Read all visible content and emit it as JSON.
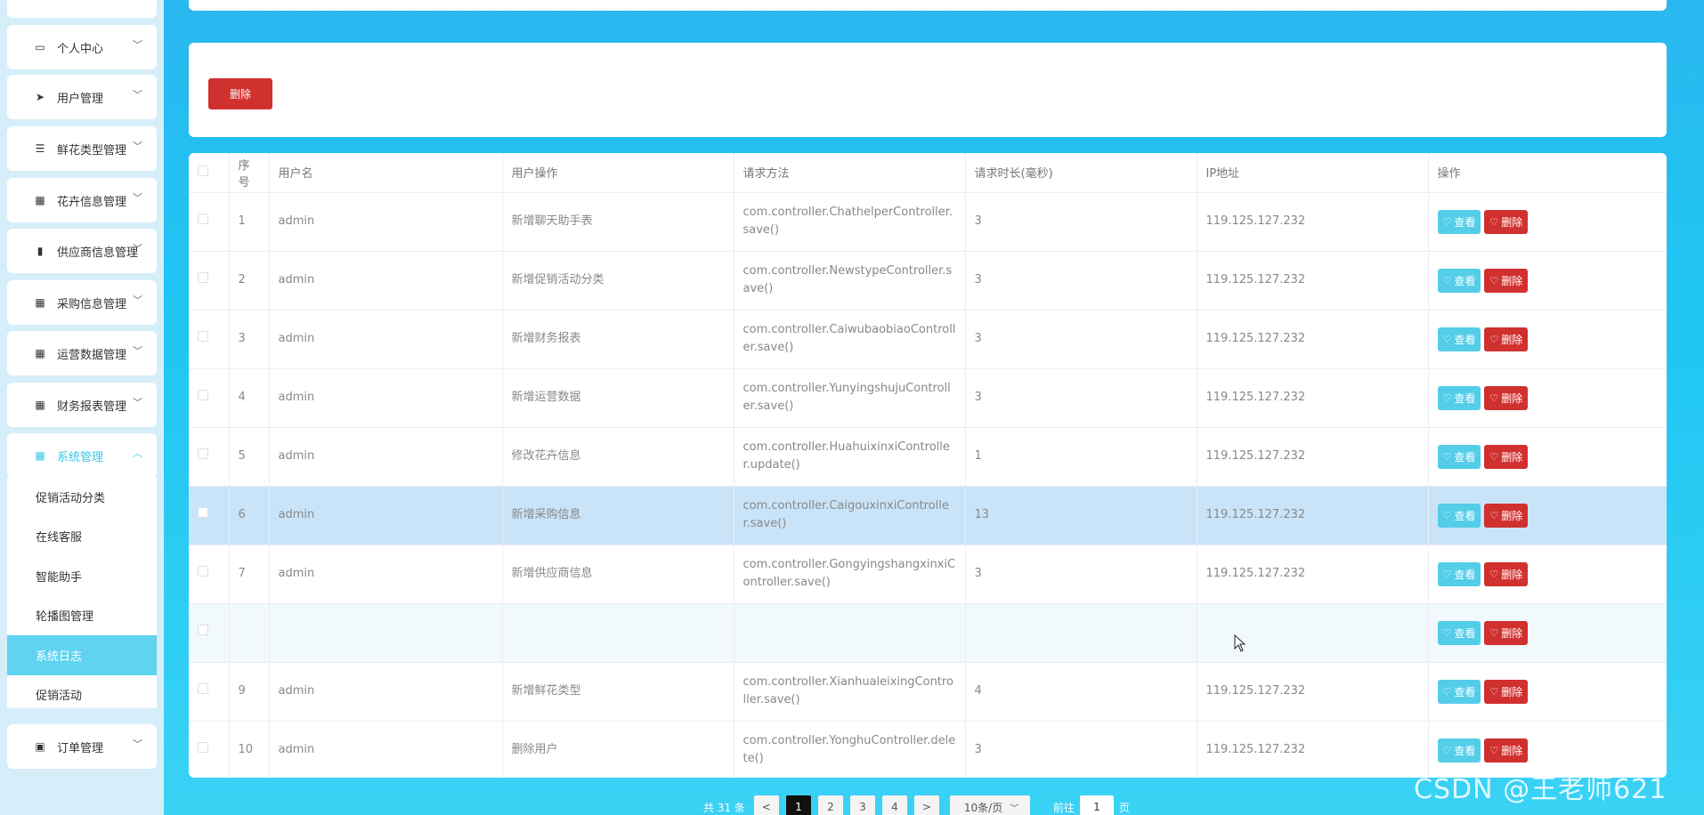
{
  "sidebar": {
    "menus": [
      {
        "label": "",
        "icon": "home-icon"
      },
      {
        "label": "个人中心",
        "icon": "calendar-icon"
      },
      {
        "label": "用户管理",
        "icon": "paper-plane-icon"
      },
      {
        "label": "鲜花类型管理",
        "icon": "list-icon"
      },
      {
        "label": "花卉信息管理",
        "icon": "grid-icon"
      },
      {
        "label": "供应商信息管理",
        "icon": "bar-chart-icon"
      },
      {
        "label": "采购信息管理",
        "icon": "grid-icon"
      },
      {
        "label": "运营数据管理",
        "icon": "grid-icon"
      },
      {
        "label": "财务报表管理",
        "icon": "grid-icon"
      },
      {
        "label": "系统管理",
        "icon": "grid-icon"
      },
      {
        "label": "订单管理",
        "icon": "clipboard-icon"
      }
    ],
    "submenu": [
      "促销活动分类",
      "在线客服",
      "智能助手",
      "轮播图管理",
      "系统日志",
      "促销活动"
    ],
    "active_submenu": "系统日志"
  },
  "toolbar": {
    "delete_label": "删除"
  },
  "table": {
    "headers": [
      "序号",
      "用户名",
      "用户操作",
      "请求方法",
      "请求时长(毫秒)",
      "IP地址",
      "操作"
    ],
    "view_label": "查看",
    "delete_label": "删除",
    "rows": [
      {
        "no": "1",
        "user": "admin",
        "op": "新增聊天助手表",
        "method": "com.controller.ChathelperController.save()",
        "time": "3",
        "ip": "119.125.127.232"
      },
      {
        "no": "2",
        "user": "admin",
        "op": "新增促销活动分类",
        "method": "com.controller.NewstypeController.save()",
        "time": "3",
        "ip": "119.125.127.232"
      },
      {
        "no": "3",
        "user": "admin",
        "op": "新增财务报表",
        "method": "com.controller.CaiwubaobiaoController.save()",
        "time": "3",
        "ip": "119.125.127.232"
      },
      {
        "no": "4",
        "user": "admin",
        "op": "新增运营数据",
        "method": "com.controller.YunyingshujuController.save()",
        "time": "3",
        "ip": "119.125.127.232"
      },
      {
        "no": "5",
        "user": "admin",
        "op": "修改花卉信息",
        "method": "com.controller.HuahuixinxiController.update()",
        "time": "1",
        "ip": "119.125.127.232"
      },
      {
        "no": "6",
        "user": "admin",
        "op": "新增采购信息",
        "method": "com.controller.CaigouxinxiController.save()",
        "time": "13",
        "ip": "119.125.127.232"
      },
      {
        "no": "7",
        "user": "admin",
        "op": "新增供应商信息",
        "method": "com.controller.GongyingshangxinxiController.save()",
        "time": "3",
        "ip": "119.125.127.232"
      },
      {
        "no": "",
        "user": "",
        "op": "",
        "method": "",
        "time": "",
        "ip": ""
      },
      {
        "no": "9",
        "user": "admin",
        "op": "新增鲜花类型",
        "method": "com.controller.XianhualeixingController.save()",
        "time": "4",
        "ip": "119.125.127.232"
      },
      {
        "no": "10",
        "user": "admin",
        "op": "删除用户",
        "method": "com.controller.YonghuController.delete()",
        "time": "3",
        "ip": "119.125.127.232"
      }
    ]
  },
  "pagination": {
    "total": "共 31 条",
    "prev": "<",
    "pages": [
      "1",
      "2",
      "3",
      "4"
    ],
    "next": ">",
    "active_page": "1",
    "page_size": "10条/页",
    "goto_label": "前往",
    "goto_value": "1",
    "goto_unit": "页"
  },
  "watermark": "CSDN @王老师621"
}
